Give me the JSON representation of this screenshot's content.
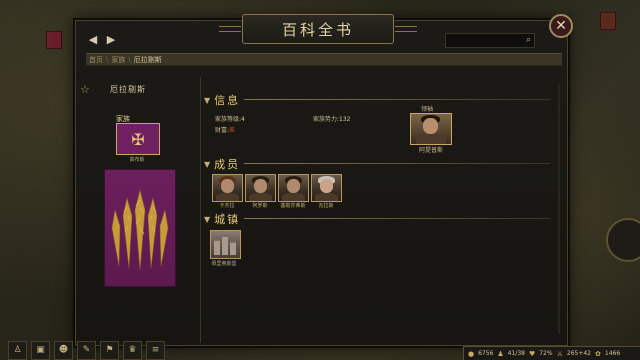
{
  "window": {
    "title": "百科全书",
    "search_placeholder": ""
  },
  "breadcrumb": {
    "items": [
      "首页",
      "家族",
      "厄拉剔斯"
    ]
  },
  "clan": {
    "name": "厄拉剔斯",
    "leader_label": "家族",
    "leader_name": "高布斯"
  },
  "info": {
    "title": "信息",
    "clan_tier_label": "家族等级:",
    "clan_tier_value": "4",
    "clan_strength_label": "家族势力:",
    "clan_strength_value": "132",
    "wealth_label": "财富:",
    "wealth_value": "差",
    "leader_role": "领袖",
    "leader_person": "阿提普斯"
  },
  "members": {
    "title": "成员",
    "items": [
      {
        "name": "卡杰拉"
      },
      {
        "name": "阿罗斯"
      },
      {
        "name": "塞勒莎弗斯"
      },
      {
        "name": "瓦拉斯"
      }
    ]
  },
  "settlements": {
    "title": "城镇",
    "items": [
      {
        "name": "佩里奥斯堡"
      }
    ]
  },
  "status_bar": {
    "gold": "6756",
    "troops": "41/38",
    "morale": "72%",
    "party": "265+42",
    "food": "1466"
  },
  "colors": {
    "accent_gold": "#e4c776",
    "banner_purple": "#6c1f5c",
    "wealth_red": "#c24d2c"
  }
}
